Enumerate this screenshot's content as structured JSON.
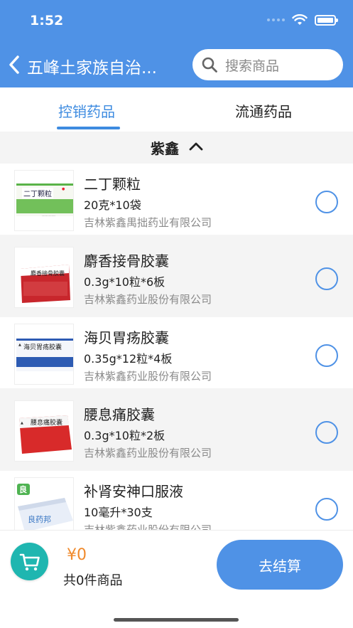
{
  "status_bar": {
    "time": "1:52"
  },
  "nav": {
    "title": "五峰土家族自治...",
    "search_placeholder": "搜索商品"
  },
  "tabs": [
    {
      "label": "控销药品",
      "active": true
    },
    {
      "label": "流通药品",
      "active": false
    }
  ],
  "filter": {
    "label": "紫鑫"
  },
  "products": [
    {
      "name": "二丁颗粒",
      "spec": "20克*10袋",
      "maker": "吉林紫鑫禺拙药业有限公司",
      "box_text": "二丁颗粒",
      "selected": false
    },
    {
      "name": "麝香接骨胶囊",
      "spec": "0.3g*10粒*6板",
      "maker": "吉林紫鑫药业股份有限公司",
      "box_text": "麝香接骨胶囊",
      "selected": false
    },
    {
      "name": "海贝胃疡胶囊",
      "spec": "0.35g*12粒*4板",
      "maker": "吉林紫鑫药业股份有限公司",
      "box_text": "海贝胃疡胶囊",
      "selected": false
    },
    {
      "name": "腰息痛胶囊",
      "spec": "0.3g*10粒*2板",
      "maker": "吉林紫鑫药业股份有限公司",
      "box_text": "腰息痛胶囊",
      "selected": false
    },
    {
      "name": "补肾安神口服液",
      "spec": "10毫升*30支",
      "maker": "吉林紫鑫药业股份有限公司",
      "box_text": "良药邦",
      "badge": "良",
      "selected": false
    }
  ],
  "cart": {
    "total": "¥0",
    "count_text": "共0件商品",
    "checkout_label": "去结算"
  },
  "colors": {
    "primary": "#4f92e6",
    "cart_button": "#1fb6b0",
    "price": "#f08a2c"
  }
}
